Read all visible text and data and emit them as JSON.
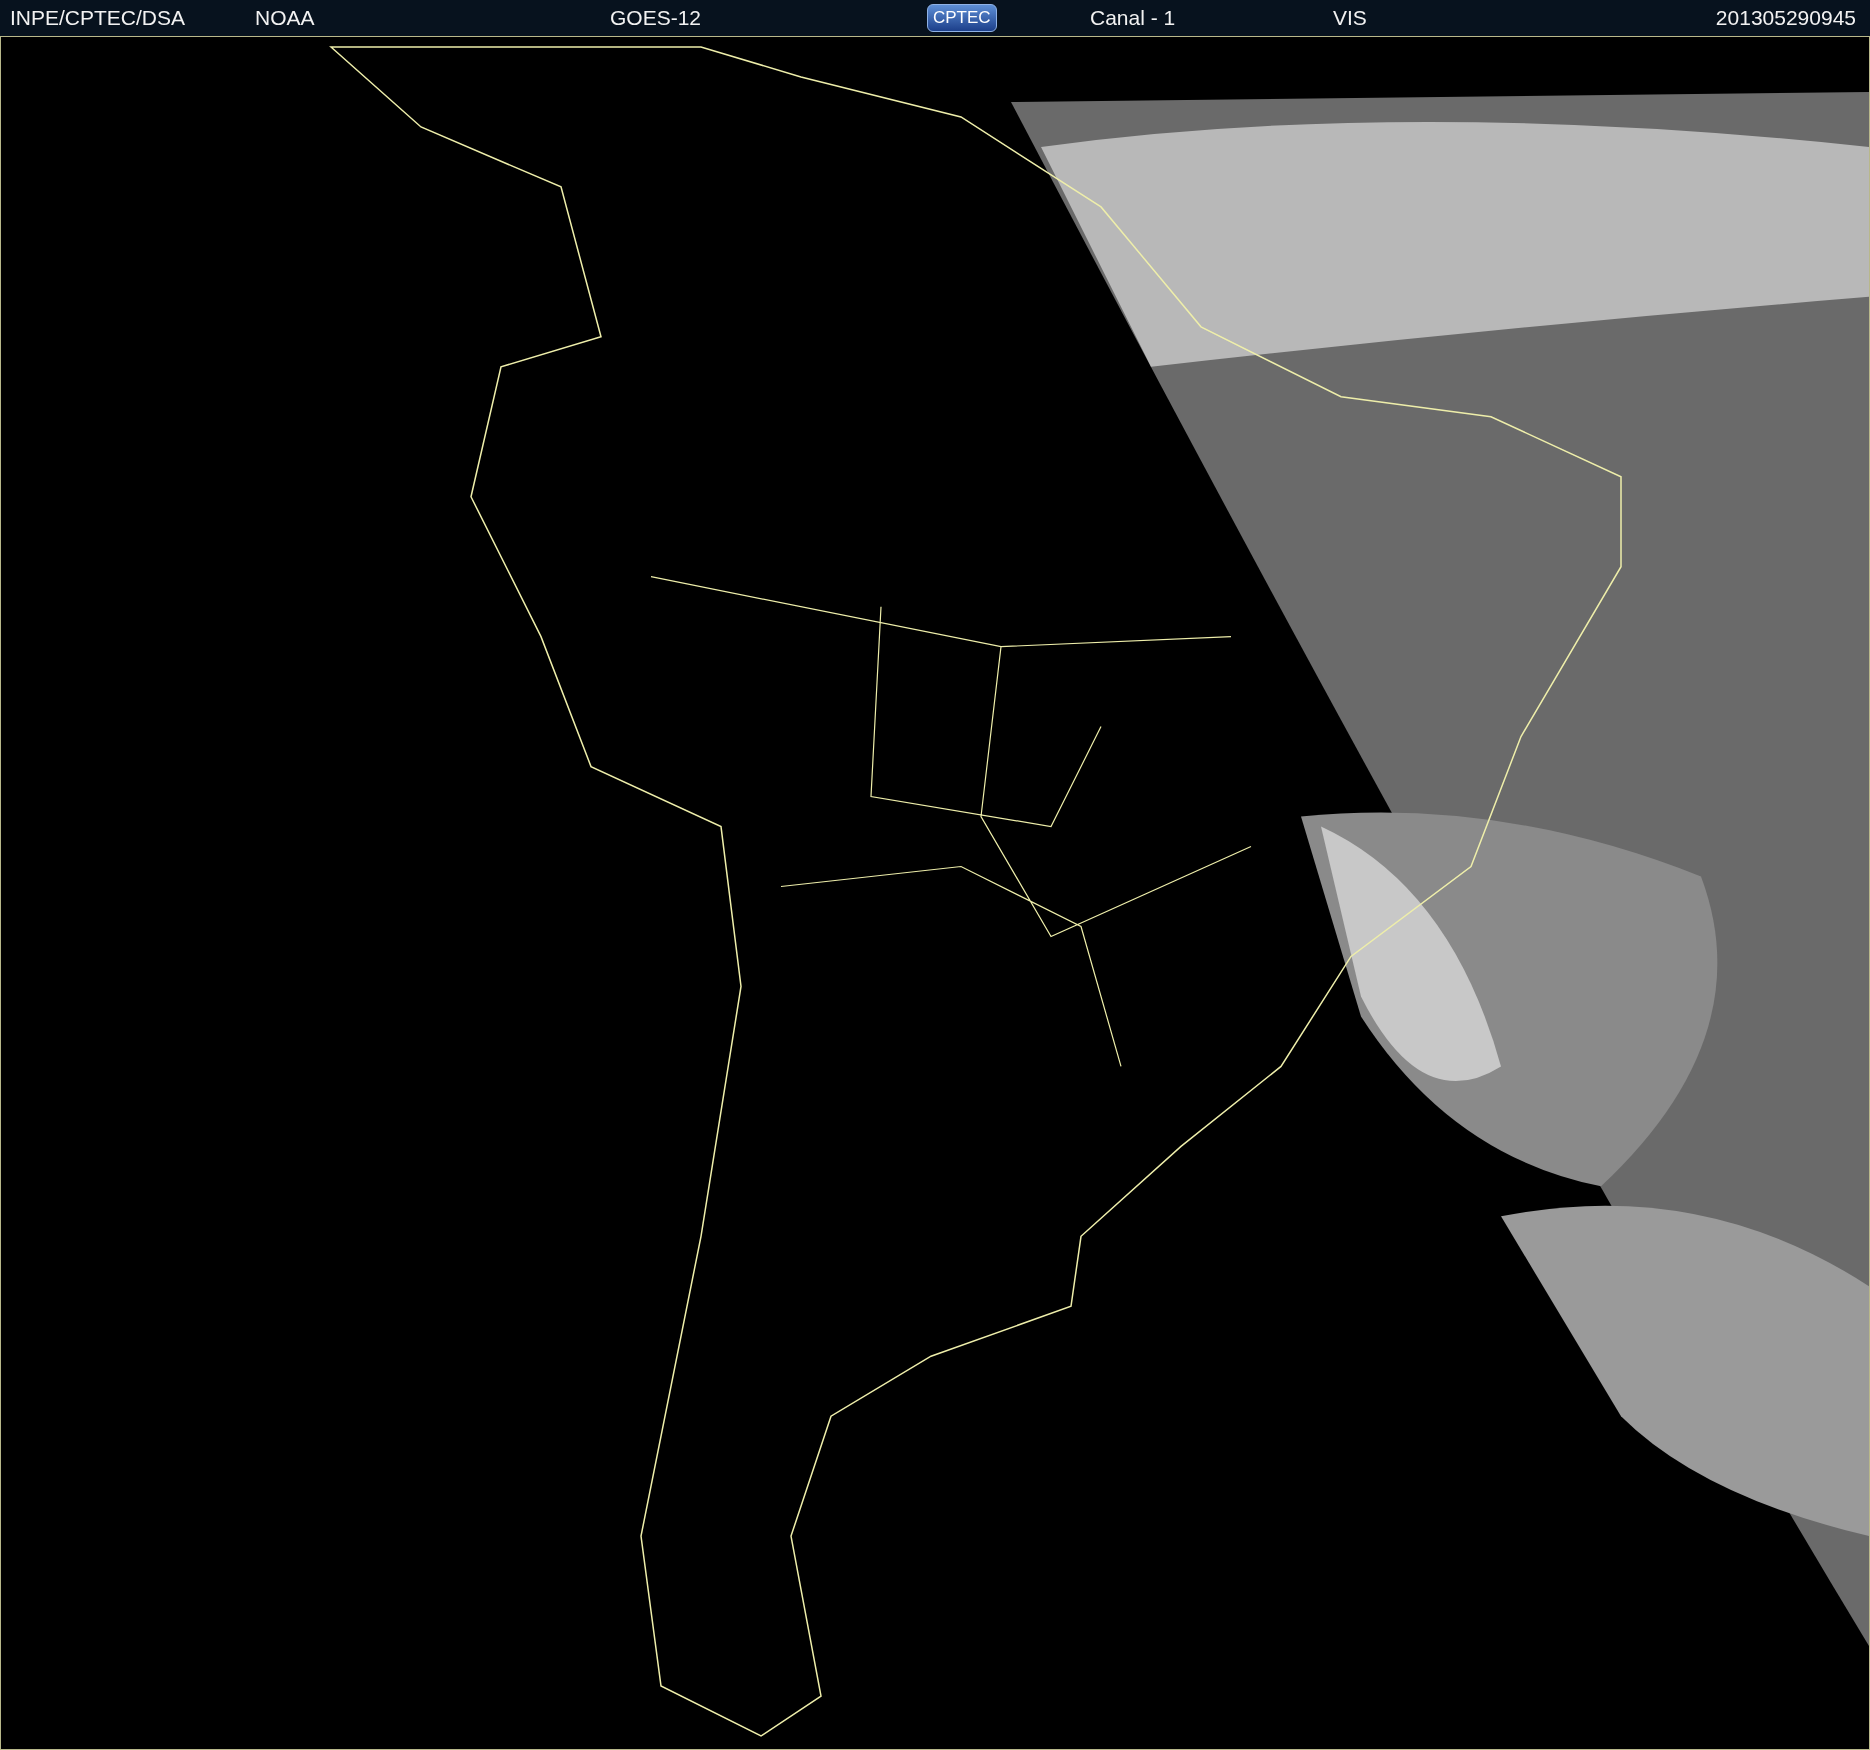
{
  "header": {
    "source": "INPE/CPTEC/DSA",
    "agency": "NOAA",
    "satellite": "GOES-12",
    "logo": "CPTEC",
    "channel": "Canal - 1",
    "band": "VIS",
    "timestamp": "201305290945"
  }
}
